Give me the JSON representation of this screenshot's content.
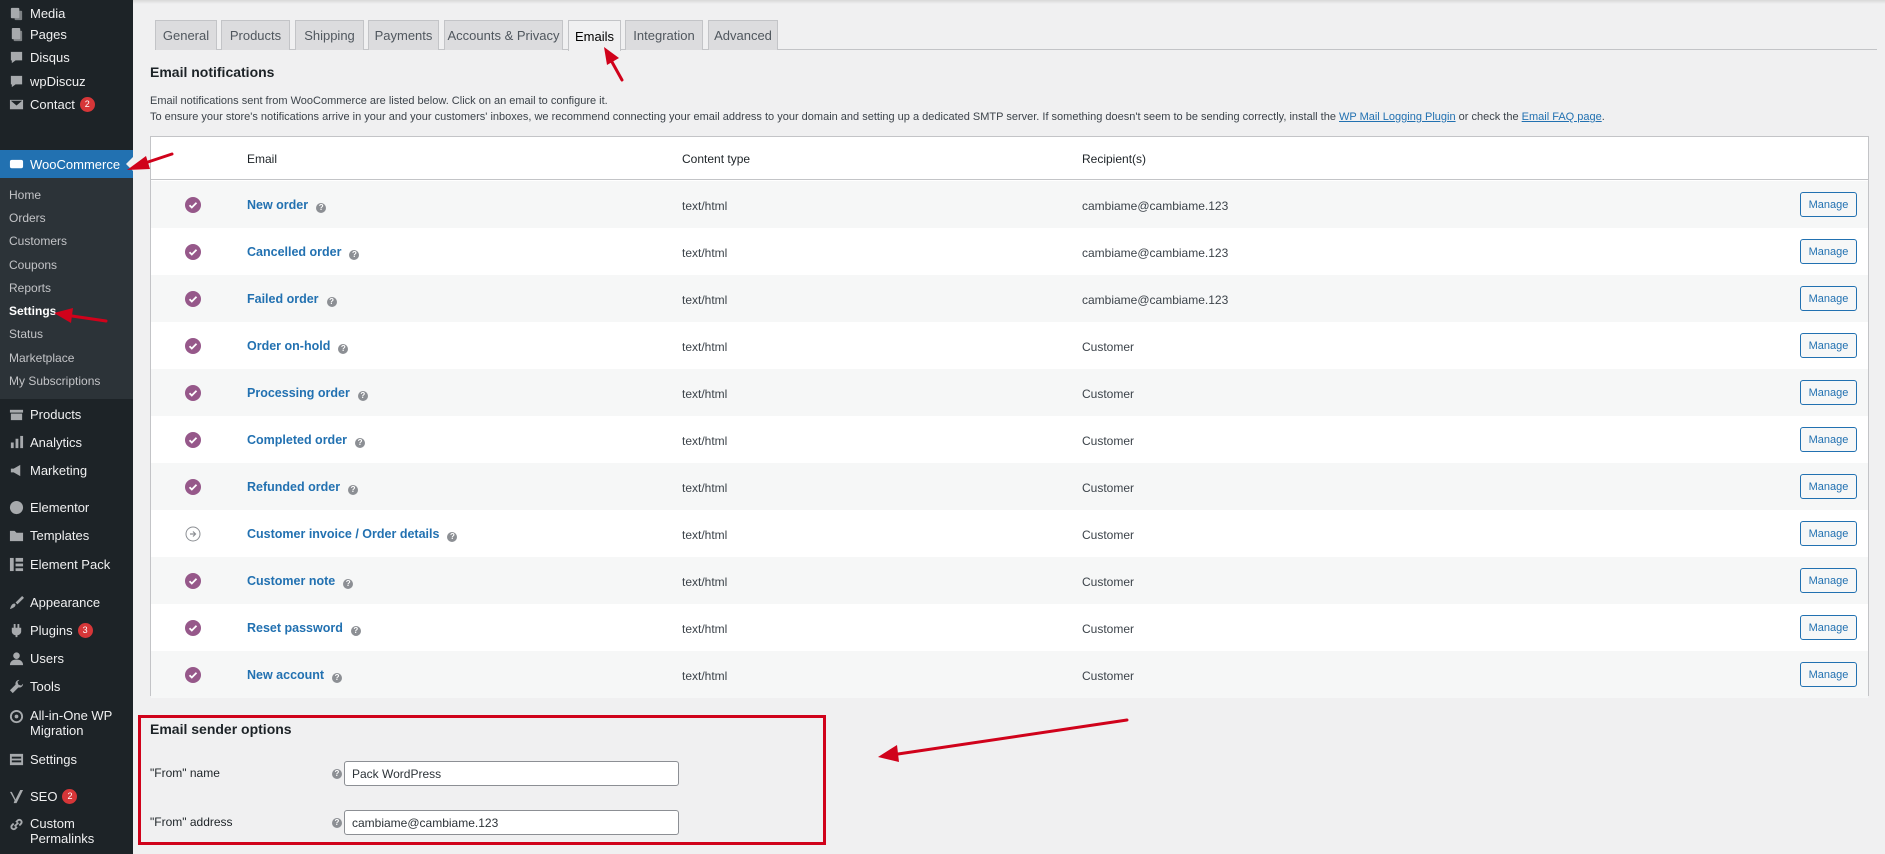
{
  "sidebar": {
    "items": [
      {
        "label": "Media",
        "icon": "media-icon"
      },
      {
        "label": "Pages",
        "icon": "pages-icon"
      },
      {
        "label": "Disqus",
        "icon": "comment-icon"
      },
      {
        "label": "wpDiscuz",
        "icon": "comment-icon"
      },
      {
        "label": "Contact",
        "icon": "mail-icon",
        "badge": "2"
      },
      {
        "label": "WooCommerce",
        "icon": "woo-icon"
      },
      {
        "label": "Products",
        "icon": "archive-icon"
      },
      {
        "label": "Analytics",
        "icon": "chart-icon"
      },
      {
        "label": "Marketing",
        "icon": "megaphone-icon"
      },
      {
        "label": "Elementor",
        "icon": "elementor-icon"
      },
      {
        "label": "Templates",
        "icon": "folder-icon"
      },
      {
        "label": "Element Pack",
        "icon": "element-pack-icon"
      },
      {
        "label": "Appearance",
        "icon": "brush-icon"
      },
      {
        "label": "Plugins",
        "icon": "plugin-icon",
        "badge": "3"
      },
      {
        "label": "Users",
        "icon": "users-icon"
      },
      {
        "label": "Tools",
        "icon": "wrench-icon"
      },
      {
        "label": "All-in-One WP Migration",
        "icon": "migration-icon"
      },
      {
        "label": "Settings",
        "icon": "settings-icon"
      },
      {
        "label": "SEO",
        "icon": "yoast-icon",
        "badge": "2"
      },
      {
        "label": "Custom Permalinks",
        "icon": "link-icon"
      }
    ],
    "submenu": [
      "Home",
      "Orders",
      "Customers",
      "Coupons",
      "Reports",
      "Settings",
      "Status",
      "Marketplace",
      "My Subscriptions"
    ]
  },
  "tabs": [
    "General",
    "Products",
    "Shipping",
    "Payments",
    "Accounts & Privacy",
    "Emails",
    "Integration",
    "Advanced"
  ],
  "active_tab": "Emails",
  "notifications": {
    "title": "Email notifications",
    "desc1": "Email notifications sent from WooCommerce are listed below. Click on an email to configure it.",
    "desc2_pre": "To ensure your store's notifications arrive in your and your customers' inboxes, we recommend connecting your email address to your domain and setting up a dedicated SMTP server. If something doesn't seem to be sending correctly, install the ",
    "link1": "WP Mail Logging Plugin",
    "desc2_mid": " or check the ",
    "link2": "Email FAQ page",
    "desc2_end": "."
  },
  "table": {
    "headers": {
      "email": "Email",
      "content_type": "Content type",
      "recipients": "Recipient(s)"
    },
    "help_glyph": "?",
    "manage_label": "Manage",
    "rows": [
      {
        "name": "New order",
        "content_type": "text/html",
        "recipient": "cambiame@cambiame.123",
        "status": "enabled"
      },
      {
        "name": "Cancelled order",
        "content_type": "text/html",
        "recipient": "cambiame@cambiame.123",
        "status": "enabled"
      },
      {
        "name": "Failed order",
        "content_type": "text/html",
        "recipient": "cambiame@cambiame.123",
        "status": "enabled"
      },
      {
        "name": "Order on-hold",
        "content_type": "text/html",
        "recipient": "Customer",
        "status": "enabled"
      },
      {
        "name": "Processing order",
        "content_type": "text/html",
        "recipient": "Customer",
        "status": "enabled"
      },
      {
        "name": "Completed order",
        "content_type": "text/html",
        "recipient": "Customer",
        "status": "enabled"
      },
      {
        "name": "Refunded order",
        "content_type": "text/html",
        "recipient": "Customer",
        "status": "enabled"
      },
      {
        "name": "Customer invoice / Order details",
        "content_type": "text/html",
        "recipient": "Customer",
        "status": "manual"
      },
      {
        "name": "Customer note",
        "content_type": "text/html",
        "recipient": "Customer",
        "status": "enabled"
      },
      {
        "name": "Reset password",
        "content_type": "text/html",
        "recipient": "Customer",
        "status": "enabled"
      },
      {
        "name": "New account",
        "content_type": "text/html",
        "recipient": "Customer",
        "status": "enabled"
      }
    ]
  },
  "sender": {
    "title": "Email sender options",
    "from_name_label": "\"From\" name",
    "from_name_value": "Pack WordPress",
    "from_address_label": "\"From\" address",
    "from_address_value": "cambiame@cambiame.123"
  },
  "colors": {
    "sidebar_bg": "#1d2327",
    "submenu_bg": "#2c3338",
    "accent_blue": "#2271b1",
    "status_purple": "#96588a",
    "annotation_red": "#d0021b"
  }
}
